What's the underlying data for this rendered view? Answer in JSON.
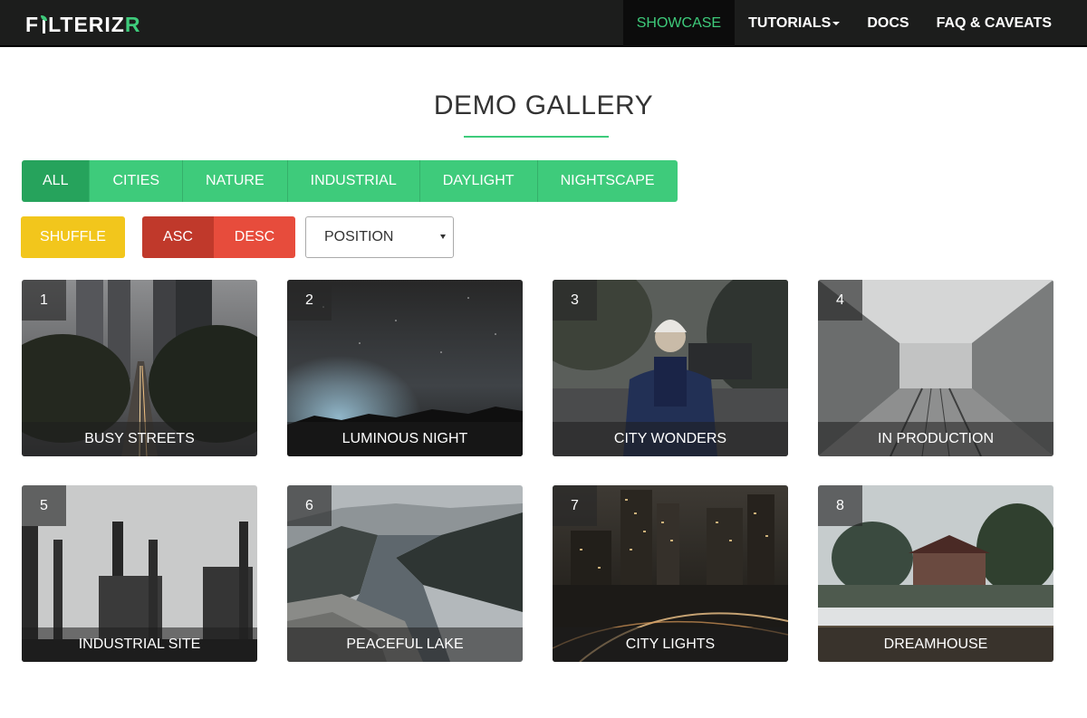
{
  "navbar": {
    "brand": {
      "part1": "F",
      "part2": "LTERIZ",
      "part3": "R"
    },
    "items": [
      {
        "label": "SHOWCASE",
        "active": true
      },
      {
        "label": "TUTORIALS",
        "dropdown": true
      },
      {
        "label": "DOCS"
      },
      {
        "label": "FAQ & CAVEATS"
      }
    ]
  },
  "page": {
    "title": "DEMO GALLERY"
  },
  "filters": [
    "ALL",
    "CITIES",
    "NATURE",
    "INDUSTRIAL",
    "DAYLIGHT",
    "NIGHTSCAPE"
  ],
  "controls": {
    "shuffle_label": "SHUFFLE",
    "asc_label": "ASC",
    "desc_label": "DESC",
    "sort_select_value": "POSITION"
  },
  "gallery": [
    {
      "number": "1",
      "caption": "BUSY STREETS"
    },
    {
      "number": "2",
      "caption": "LUMINOUS NIGHT"
    },
    {
      "number": "3",
      "caption": "CITY WONDERS"
    },
    {
      "number": "4",
      "caption": "IN PRODUCTION"
    },
    {
      "number": "5",
      "caption": "INDUSTRIAL SITE"
    },
    {
      "number": "6",
      "caption": "PEACEFUL LAKE"
    },
    {
      "number": "7",
      "caption": "CITY LIGHTS"
    },
    {
      "number": "8",
      "caption": "DREAMHOUSE"
    }
  ],
  "colors": {
    "accent": "#3ecb7b",
    "accent_active": "#26a35c",
    "shuffle": "#f2c61c",
    "asc": "#c0392b",
    "desc": "#e74c3c",
    "navbar": "#1c1d1c"
  }
}
